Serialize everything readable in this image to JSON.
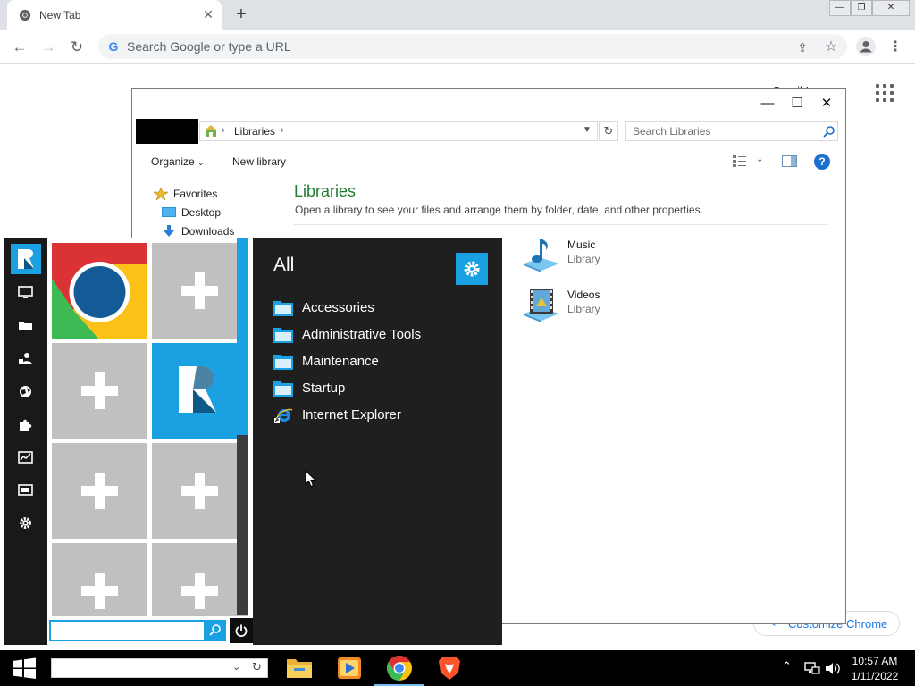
{
  "browser": {
    "tab_title": "New Tab",
    "omnibox_placeholder": "Search Google or type a URL",
    "window_controls": {
      "minimize": "—",
      "restore": "❐",
      "close": "✕"
    }
  },
  "ntp": {
    "partial_link": "Gmail  Images",
    "customize_label": "Customize Chrome"
  },
  "explorer": {
    "breadcrumb": "Libraries",
    "search_placeholder": "Search Libraries",
    "commands": {
      "organize": "Organize",
      "new_library": "New library"
    },
    "nav_tree": [
      {
        "label": "Favorites",
        "icon": "star-icon"
      },
      {
        "label": "Desktop",
        "icon": "desktop-icon"
      },
      {
        "label": "Downloads",
        "icon": "downloads-icon"
      }
    ],
    "title": "Libraries",
    "description": "Open a library to see your files and arrange them by folder, date, and other properties.",
    "libraries": [
      {
        "name": "Music",
        "type": "Library",
        "icon": "music-library-icon"
      },
      {
        "name": "Videos",
        "type": "Library",
        "icon": "videos-library-icon"
      }
    ]
  },
  "start_menu": {
    "all_title": "All",
    "sidebar_icons": [
      "computer-icon",
      "folder-icon",
      "users-icon",
      "network-icon",
      "puzzle-icon",
      "monitor-graph-icon",
      "display-icon",
      "settings-icon"
    ],
    "tiles": [
      {
        "name": "tile-chrome",
        "kind": "chrome"
      },
      {
        "name": "tile-add-1",
        "kind": "add"
      },
      {
        "name": "tile-add-2",
        "kind": "add"
      },
      {
        "name": "tile-r-app",
        "kind": "r-app"
      },
      {
        "name": "tile-add-3",
        "kind": "add"
      },
      {
        "name": "tile-add-4",
        "kind": "add"
      },
      {
        "name": "tile-add-5",
        "kind": "add"
      },
      {
        "name": "tile-add-6",
        "kind": "add"
      }
    ],
    "entries": [
      {
        "label": "Accessories",
        "icon": "folder-icon"
      },
      {
        "label": "Administrative Tools",
        "icon": "folder-icon"
      },
      {
        "label": "Maintenance",
        "icon": "folder-icon"
      },
      {
        "label": "Startup",
        "icon": "folder-icon"
      },
      {
        "label": "Internet Explorer",
        "icon": "internet-explorer-icon"
      }
    ],
    "search_value": "",
    "accent_color": "#1ba1e2"
  },
  "taskbar": {
    "apps": [
      "file-explorer-icon",
      "media-player-icon",
      "chrome-icon",
      "brave-icon"
    ],
    "time": "10:57 AM",
    "date": "1/11/2022"
  }
}
